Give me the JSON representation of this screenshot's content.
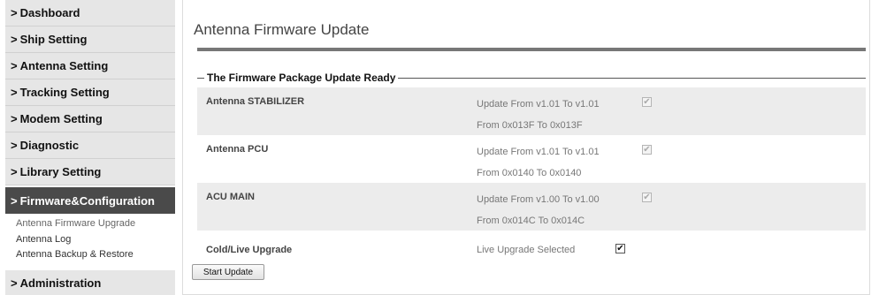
{
  "sidebar": {
    "items": [
      {
        "label": "Dashboard"
      },
      {
        "label": "Ship Setting"
      },
      {
        "label": "Antenna Setting"
      },
      {
        "label": "Tracking Setting"
      },
      {
        "label": "Modem Setting"
      },
      {
        "label": "Diagnostic"
      },
      {
        "label": "Library Setting"
      },
      {
        "label": "Firmware&Configuration"
      },
      {
        "label": "Administration"
      }
    ],
    "chevron": ">",
    "subitems": [
      {
        "label": "Antenna Firmware Upgrade"
      },
      {
        "label": "Antenna Log"
      },
      {
        "label": "Antenna Backup & Restore"
      }
    ]
  },
  "main": {
    "title": "Antenna Firmware Update",
    "section_title": "The Firmware Package Update Ready",
    "rows": [
      {
        "name": "Antenna STABILIZER",
        "update": "Update From v1.01 To v1.01",
        "from": "From 0x013F To 0x013F",
        "checked": true
      },
      {
        "name": "Antenna PCU",
        "update": "Update From v1.01 To v1.01",
        "from": "From 0x0140 To 0x0140",
        "checked": true
      },
      {
        "name": "ACU MAIN",
        "update": "Update From v1.00 To v1.00",
        "from": "From 0x014C To 0x014C",
        "checked": true
      }
    ],
    "upgrade": {
      "label": "Cold/Live Upgrade",
      "value": "Live Upgrade Selected",
      "checked": true
    },
    "start_button": "Start Update"
  }
}
